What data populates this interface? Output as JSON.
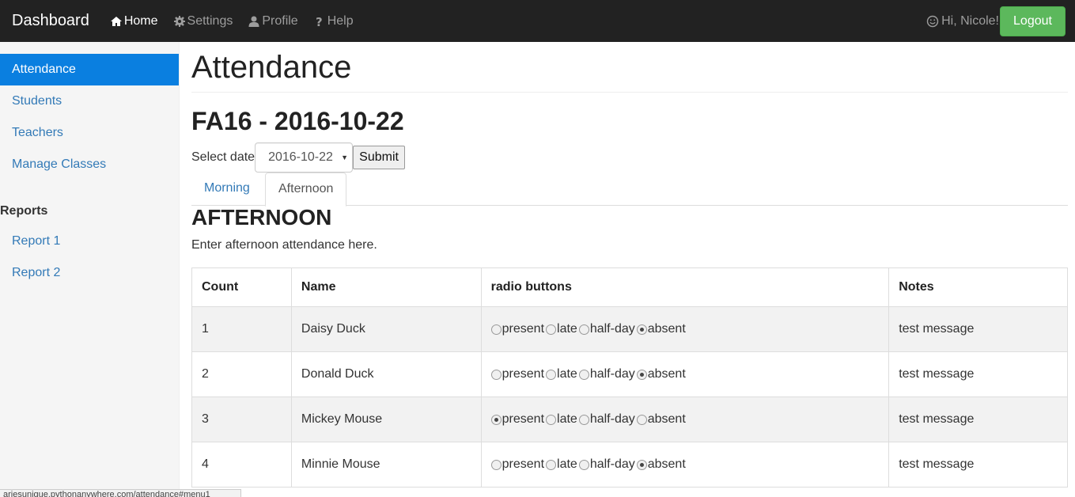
{
  "navbar": {
    "brand": "Dashboard",
    "items": [
      {
        "label": "Home",
        "icon": "home-icon",
        "active": true
      },
      {
        "label": "Settings",
        "icon": "cog-icon",
        "active": false
      },
      {
        "label": "Profile",
        "icon": "user-icon",
        "active": false
      },
      {
        "label": "Help",
        "icon": "question-icon",
        "active": false
      }
    ],
    "greeting": "Hi, Nicole!",
    "greeting_icon": "smile-icon",
    "logout_label": "Logout"
  },
  "sidebar": {
    "items": [
      {
        "label": "Attendance",
        "active": true
      },
      {
        "label": "Students"
      },
      {
        "label": "Teachers"
      },
      {
        "label": "Manage Classes"
      }
    ],
    "reports_heading": "Reports",
    "reports": [
      {
        "label": "Report 1"
      },
      {
        "label": "Report 2"
      }
    ]
  },
  "main": {
    "page_title": "Attendance",
    "sub_title": "FA16 - 2016-10-22",
    "select_label": "Select date",
    "selected_date": "2016-10-22",
    "submit_label": "Submit",
    "tabs": [
      {
        "label": "Morning",
        "active": false
      },
      {
        "label": "Afternoon",
        "active": true
      }
    ],
    "section_title": "AFTERNOON",
    "section_desc": "Enter afternoon attendance here."
  },
  "table": {
    "headers": [
      "Count",
      "Name",
      "radio buttons",
      "Notes"
    ],
    "radio_options": [
      "present",
      "late",
      "half-day",
      "absent"
    ],
    "rows": [
      {
        "count": "1",
        "name": "Daisy Duck",
        "selected": "absent",
        "notes": "test message"
      },
      {
        "count": "2",
        "name": "Donald Duck",
        "selected": "absent",
        "notes": "test message"
      },
      {
        "count": "3",
        "name": "Mickey Mouse",
        "selected": "present",
        "notes": "test message"
      },
      {
        "count": "4",
        "name": "Minnie Mouse",
        "selected": "absent",
        "notes": "test message"
      }
    ]
  },
  "status_bar": {
    "url": "ariesunique.pythonanywhere.com/attendance#menu1"
  },
  "colors": {
    "navbar_bg": "#222222",
    "active_sidebar": "#0a7fe0",
    "link": "#337ab7",
    "logout_btn": "#5cb85c"
  }
}
